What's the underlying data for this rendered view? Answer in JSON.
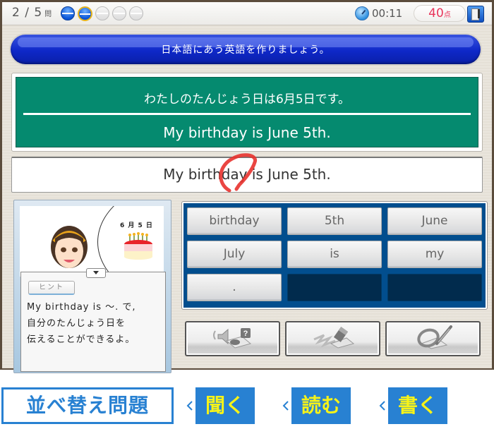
{
  "status_bar": {
    "question_progress": "2 / 5",
    "question_unit": "問",
    "current_question": 2,
    "total_questions": 5,
    "progress_dots": [
      "done",
      "current",
      "pending",
      "pending",
      "pending"
    ],
    "timer": "00:11",
    "score_value": "40",
    "score_unit": "点",
    "icons": {
      "timer": "clock-icon",
      "exit": "exit-door-icon"
    }
  },
  "instruction": "日本語にあう英語を作りましょう。",
  "question": {
    "japanese": "わたしのたんじょう日は6月5日です。",
    "english": "My birthday is June 5th."
  },
  "answer": {
    "text": "My birthday is June 5th.",
    "result_mark": "correct-circle-icon"
  },
  "hint_panel": {
    "scene_date": "6 月 5 日",
    "hint_button_label": "ヒント",
    "hint_text": "My birthday is  ～. で,\n自分のたんじょう日を\n伝えることができるよ。",
    "colors": {
      "panel_bg": "#a7c7e0"
    }
  },
  "word_tiles": [
    {
      "label": "birthday",
      "empty": false
    },
    {
      "label": "5th",
      "empty": false
    },
    {
      "label": "June",
      "empty": false
    },
    {
      "label": "July",
      "empty": false
    },
    {
      "label": "is",
      "empty": false
    },
    {
      "label": "my",
      "empty": false
    },
    {
      "label": ".",
      "empty": false
    },
    {
      "label": "",
      "empty": true
    },
    {
      "label": "",
      "empty": true
    }
  ],
  "mode_buttons": [
    {
      "name": "listen-mode-button",
      "icon": "speaker-question-icon"
    },
    {
      "name": "erase-mode-button",
      "icon": "eraser-icon"
    },
    {
      "name": "write-mode-button",
      "icon": "pen-check-icon"
    }
  ],
  "bottom_nav": {
    "title": "並べ替え問題",
    "steps": [
      "聞く",
      "読む",
      "書く"
    ],
    "colors": {
      "accent": "#2881d2",
      "step_text": "#f7f318"
    }
  },
  "colors": {
    "banner": "#0e28c8",
    "question_board": "#058a6f",
    "tile_panel": "#024e8e",
    "score_text": "#e8345a",
    "correct_mark": "#e8322e"
  }
}
